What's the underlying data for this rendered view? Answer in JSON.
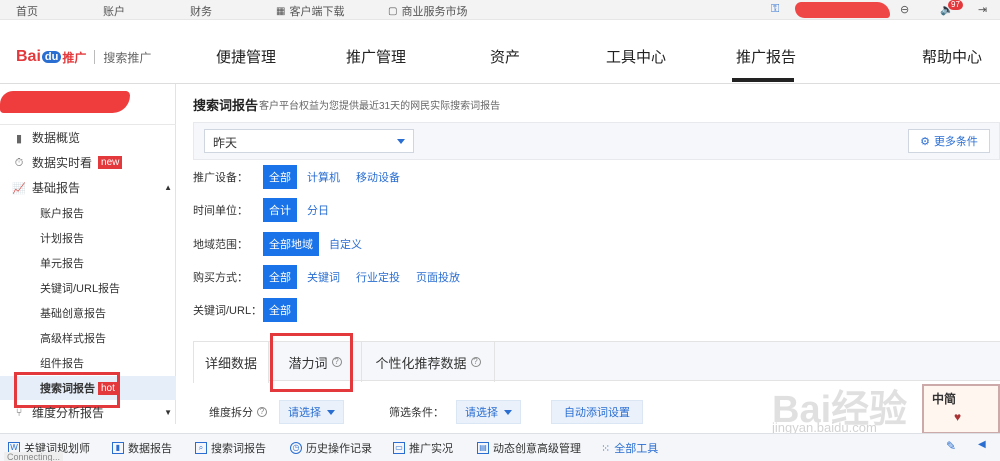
{
  "topbar": {
    "home": "首页",
    "account": "账户",
    "finance": "财务",
    "client_download": "客户端下载",
    "biz_market": "商业服务市场",
    "badge_count": "97"
  },
  "brand": {
    "logo_text": "Bai",
    "logo_du": "du",
    "logo_tg": "推广",
    "product": "搜索推广"
  },
  "nav": {
    "items": [
      "便捷管理",
      "推广管理",
      "资产",
      "工具中心",
      "推广报告",
      "帮助中心"
    ],
    "active": "推广报告"
  },
  "sidebar": {
    "overview": "数据概览",
    "realtime": "数据实时看",
    "new_badge": "new",
    "basic_report": "基础报告",
    "sub_items": [
      "账户报告",
      "计划报告",
      "单元报告",
      "关键词/URL报告",
      "基础创意报告",
      "高级样式报告",
      "组件报告"
    ],
    "search_term_report": "搜索词报告",
    "hot_badge": "hot",
    "dimension_report": "维度分析报告"
  },
  "main": {
    "title": "搜索词报告",
    "description": "客户平台权益为您提供最近31天的网民实际搜索词报告",
    "date_select": "昨天",
    "more_conditions": "更多条件",
    "filters": [
      {
        "label": "推广设备：",
        "options": [
          "全部",
          "计算机",
          "移动设备"
        ],
        "selected": 0
      },
      {
        "label": "时间单位：",
        "options": [
          "合计",
          "分日"
        ],
        "selected": 0
      },
      {
        "label": "地域范围：",
        "options": [
          "全部地域",
          "自定义"
        ],
        "selected": 0
      },
      {
        "label": "购买方式：",
        "options": [
          "全部",
          "关键词",
          "行业定投",
          "页面投放"
        ],
        "selected": 0
      },
      {
        "label": "关键词/URL：",
        "options": [
          "全部"
        ],
        "selected": 0
      }
    ],
    "tabs": [
      "详细数据",
      "潜力词",
      "个性化推荐数据"
    ],
    "dimension_label": "维度拆分",
    "dimension_select": "请选择",
    "filter_label": "筛选条件：",
    "filter_select": "请选择",
    "auto_add": "自动添词设置"
  },
  "bottombar": {
    "items": [
      "关键词规划师",
      "数据报告",
      "搜索词报告",
      "历史操作记录",
      "推广实况",
      "动态创意高级管理",
      "全部工具"
    ]
  },
  "status_text": "Connecting...",
  "watermark": {
    "text": "Bai经验",
    "url": "jingyan.baidu.com",
    "stamp": "中简"
  },
  "colors": {
    "accent_blue": "#1a73e8",
    "brand_red": "#e4393c",
    "highlight_box": "#e4393c"
  }
}
